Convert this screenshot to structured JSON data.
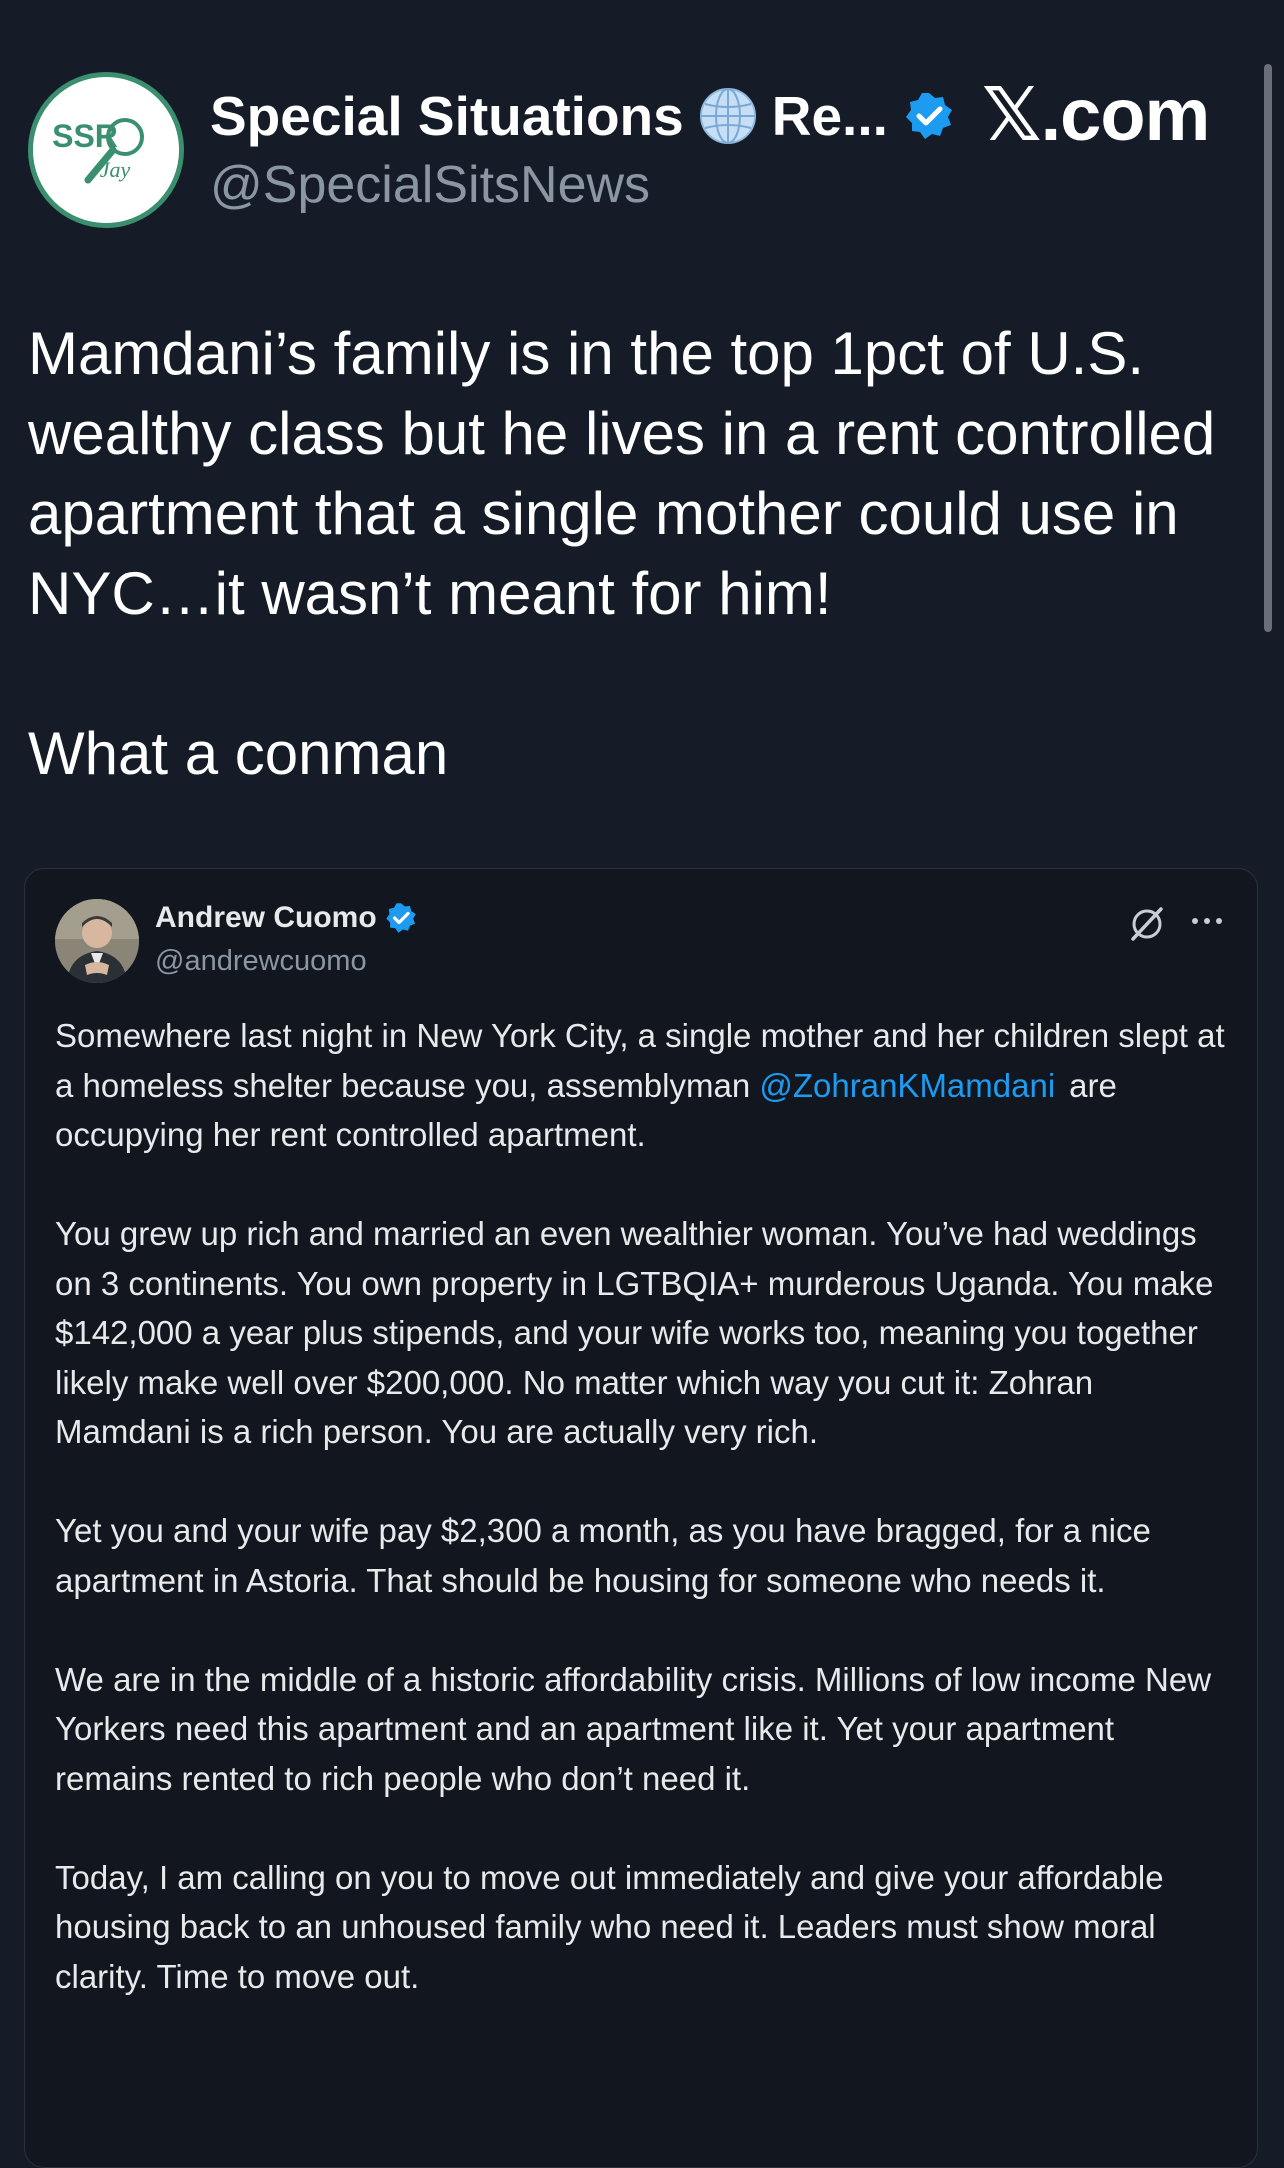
{
  "header": {
    "author_name": "Special Situations",
    "author_name_suffix": "Re...",
    "author_handle": "@SpecialSitsNews",
    "avatar_text_top": "SSR",
    "avatar_text_bottom": "Jay",
    "site_label_x": "𝕏",
    "site_label_rest": ".com",
    "icons": {
      "globe": "globe-icon",
      "verified": "verified-badge-icon"
    }
  },
  "tweet": {
    "paragraphs": [
      "Mamdani’s family is in the top 1pct of U.S. wealthy class but he lives in a rent controlled apartment that a single mother could use in NYC…it wasn’t meant for him!",
      "What a conman"
    ]
  },
  "quoted": {
    "author_name": "Andrew Cuomo",
    "author_handle": "@andrewcuomo",
    "icons": {
      "verified": "verified-badge-icon",
      "grok": "grok-icon",
      "more": "more-options-icon"
    },
    "para1_before": "Somewhere last night in New York City, a single mother and her children slept at a homeless shelter because you, assemblyman",
    "para1_mention": "@ZohranKMamdani",
    "para1_after": "are occupying her rent controlled apartment.",
    "paragraphs": [
      "You grew up rich and married an even wealthier woman. You’ve had weddings on 3 continents. You own property in LGTBQIA+ murderous Uganda. You make $142,000 a year plus stipends, and your wife works too, meaning you together likely make well over $200,000. No matter which way you cut it: Zohran Mamdani is a rich person. You are actually very rich.",
      "Yet you and your wife pay $2,300 a month, as you have bragged, for a nice apartment in Astoria. That should be housing for someone who needs it.",
      "We are in the middle of a historic affordability crisis. Millions of low income New Yorkers need this apartment and an apartment like it. Yet your apartment remains rented to rich people who don’t need it.",
      "Today, I am calling on you to move out immediately and give your affordable housing back to an unhoused family who need it. Leaders must show moral clarity. Time to move out."
    ]
  },
  "colors": {
    "background": "#151c27",
    "card_background": "#11161f",
    "text_primary": "#ffffff",
    "text_secondary": "#8b96a3",
    "link": "#1d9bf0",
    "verified": "#1d9bf0",
    "avatar_green": "#3a8f6f"
  }
}
